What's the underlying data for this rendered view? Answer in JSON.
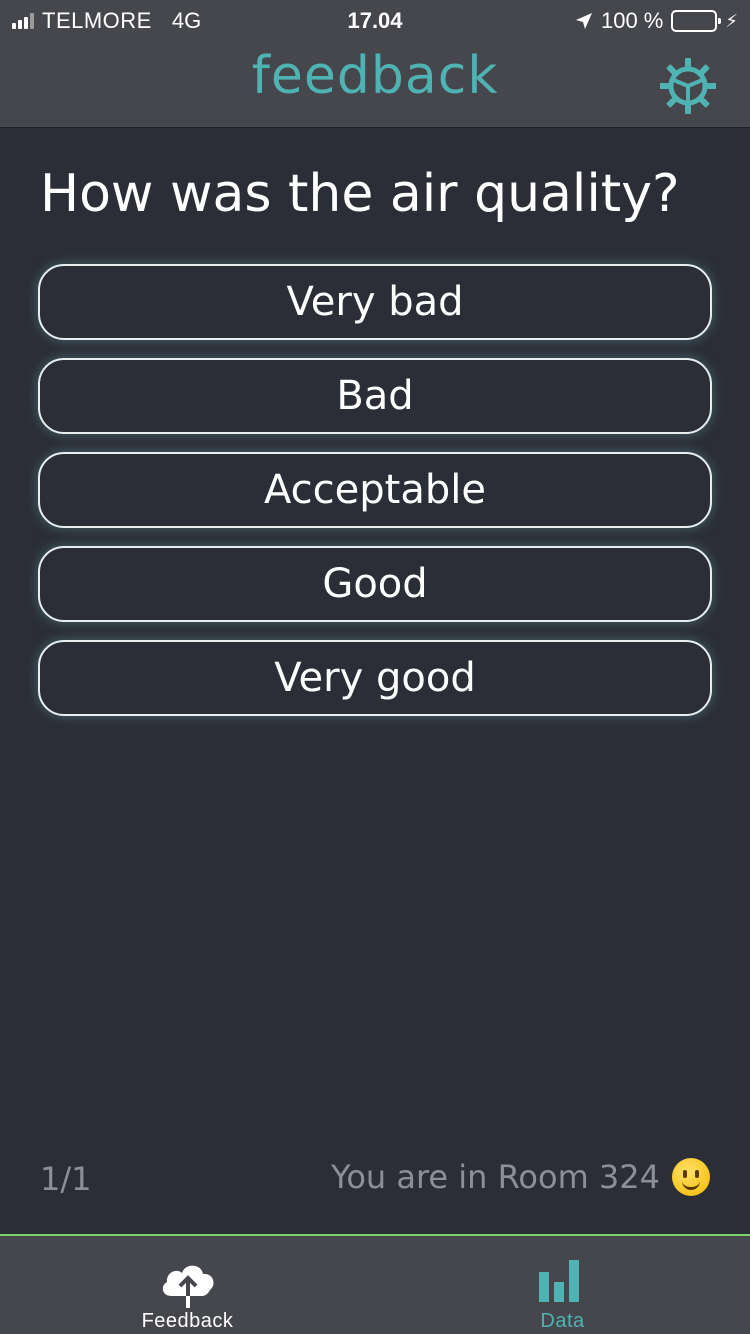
{
  "status_bar": {
    "carrier": "TELMORE",
    "network": "4G",
    "time": "17.04",
    "battery": "100 %"
  },
  "header": {
    "title": "feedback"
  },
  "question": "How was the air quality?",
  "options": [
    "Very bad",
    "Bad",
    "Acceptable",
    "Good",
    "Very good"
  ],
  "footer": {
    "page": "1/1",
    "room": "You are in Room 324"
  },
  "tabs": {
    "feedback": "Feedback",
    "data": "Data"
  },
  "colors": {
    "accent": "#4fb3b3",
    "background": "#2b2e36",
    "bar": "#45474c",
    "tab_border": "#7bd36a",
    "battery": "#58d45f"
  },
  "icons": {
    "settings": "gear-icon",
    "feedback_tab": "cloud-upload-icon",
    "data_tab": "bar-chart-icon",
    "location": "location-arrow-icon",
    "emoji": "smiley-icon"
  }
}
